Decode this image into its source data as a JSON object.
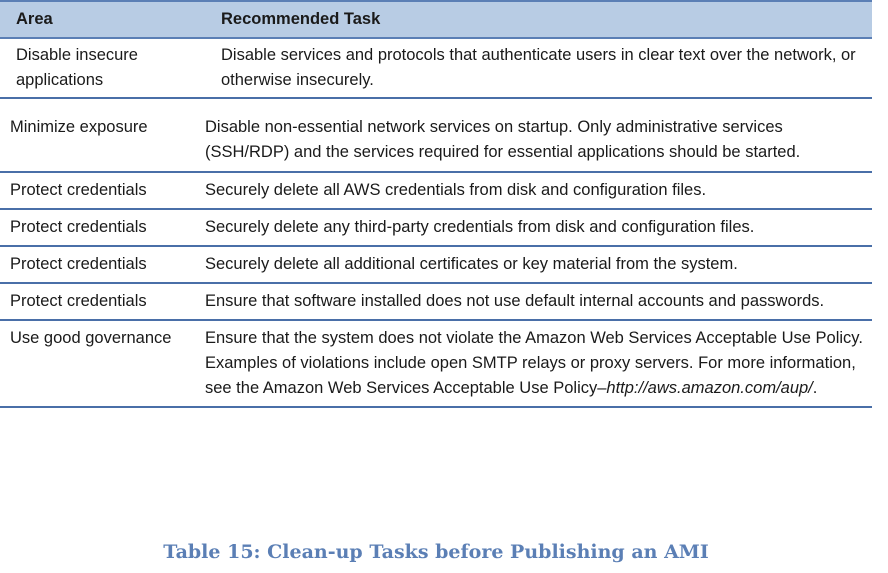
{
  "table": {
    "headers": [
      "Area",
      "Recommended Task"
    ],
    "rows": [
      {
        "area": "Disable insecure applications",
        "task": "Disable services and protocols that authenticate users in clear text over the network, or  otherwise insecurely."
      },
      {
        "area": "Minimize exposure",
        "task": "Disable non-essential network services on startup. Only administrative services (SSH/RDP) and the services required for essential applications should be started."
      },
      {
        "area": "Protect credentials",
        "task": "Securely delete all AWS credentials from disk and configuration files."
      },
      {
        "area": "Protect credentials",
        "task": "Securely delete any third-party credentials from disk and configuration files."
      },
      {
        "area": "Protect credentials",
        "task": "Securely delete all additional certificates or key material from the system."
      },
      {
        "area": "Protect credentials",
        "task": "Ensure that software installed does not use default internal accounts and passwords."
      },
      {
        "area": "Use good governance",
        "task": "Ensure that the system does not violate the Amazon Web Services Acceptable Use Policy. Examples of violations include open SMTP relays or proxy servers. For more information, see the Amazon Web Services Acceptable Use Policy–",
        "task_link": "http://aws.amazon.com/aup/",
        "task_end": "."
      }
    ]
  },
  "caption": "Table 15: Clean-up Tasks before Publishing an AMI"
}
